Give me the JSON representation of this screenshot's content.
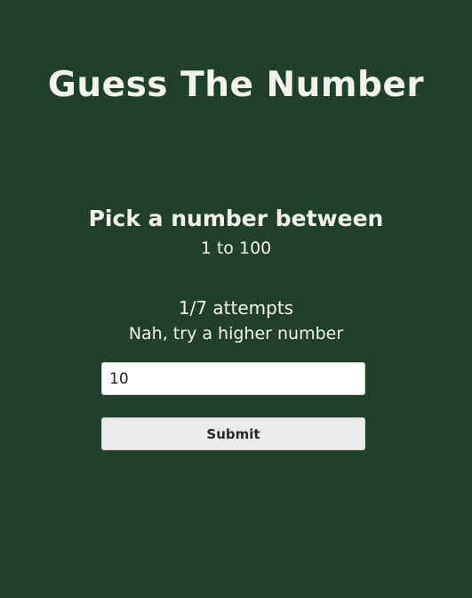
{
  "title": "Guess The Number",
  "prompt": {
    "main": "Pick a number between",
    "range": "1 to 100"
  },
  "status": {
    "attempts": "1/7 attempts",
    "feedback": "Nah, try a higher number"
  },
  "guess": {
    "value": "10"
  },
  "submit_label": "Submit",
  "colors": {
    "background": "#21402c",
    "text": "#f2f2ee",
    "input_bg": "#ffffff",
    "button_bg": "#ebebeb"
  }
}
